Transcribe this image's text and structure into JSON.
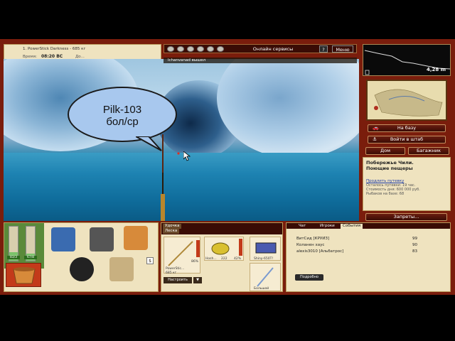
{
  "info": {
    "tackle_line": "1. PowerStick Darkness - 685 кг",
    "time_label": "Время:",
    "time_value": "08:20 ВС",
    "extra_label": "До..."
  },
  "topbar": {
    "online_services": "Онлайн сервисы",
    "help": "?",
    "menu": "Меню"
  },
  "log_line": "lchanvanad вышел",
  "bubble": {
    "line1": "Pilk-103",
    "line2": "бол/ср"
  },
  "depth": {
    "value": "4,28 m"
  },
  "side_buttons": {
    "to_base": "На базу",
    "to_hq": "Войти в штаб",
    "home": "Дом",
    "luggage": "Багажник",
    "bans": "Запреты..."
  },
  "place": {
    "title_line1": "Побережье Чили.",
    "title_line2": "Поющие пещеры",
    "extend_link": "Продлить путевку",
    "remaining": "Осталось путевки: 19 час.",
    "cost": "Стоимость дня: 600 000 руб.",
    "fishers": "Рыбаков на базе: 68"
  },
  "inventory": {
    "bar1_label": "83/3",
    "bar2_label": "67/8",
    "bar1_level": 0.25,
    "bar2_level": 0.2
  },
  "tackle": {
    "tab_line1": "Удочка",
    "tab_line2": "Леска",
    "rod_name": "PowerStic...",
    "rod_weight": "685 кг",
    "rod_pct": "86%",
    "reel_name": "Hosh...",
    "reel_num": "222",
    "reel_pct": "42%",
    "lure_name": "Shiny-650T!",
    "hook_name": "Большой",
    "configure": "Настроить",
    "configure_arrow": "▼"
  },
  "chat": {
    "tabs": [
      "Чат",
      "Игроки",
      "События"
    ],
    "active_tab": 2,
    "rows": [
      {
        "name": "ВитСид [КРУИЗ]",
        "score": "99"
      },
      {
        "name": "Коланен хаус",
        "score": "90"
      },
      {
        "name": "alexis3010 [Альбатрос]",
        "score": "83"
      }
    ],
    "more": "Подробно"
  },
  "colors": {
    "frame": "#7a1d0c",
    "panel": "#efe3bf",
    "water": "#116a98"
  }
}
